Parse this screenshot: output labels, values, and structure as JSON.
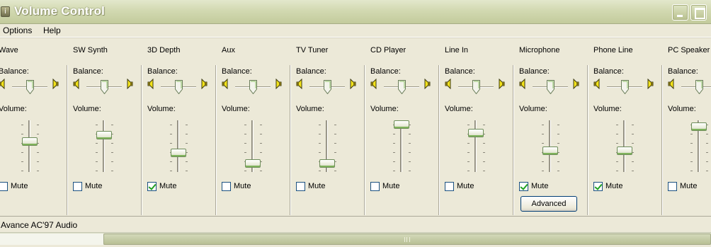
{
  "window": {
    "title": "Volume Control",
    "icon": "volume-app-icon",
    "accent": "#C3CB9C"
  },
  "menu": [
    "Options",
    "Help"
  ],
  "labels": {
    "balance": "Balance:",
    "volume": "Volume:",
    "mute": "Mute",
    "advanced": "Advanced"
  },
  "channels": [
    {
      "name": "Wave",
      "balance": 0.5,
      "volume": 0.6,
      "muted": false
    },
    {
      "name": "SW Synth",
      "balance": 0.5,
      "volume": 0.75,
      "muted": false
    },
    {
      "name": "3D Depth",
      "balance": 0.5,
      "volume": 0.35,
      "muted": true
    },
    {
      "name": "Aux",
      "balance": 0.5,
      "volume": 0.1,
      "muted": false
    },
    {
      "name": "TV Tuner",
      "balance": 0.5,
      "volume": 0.1,
      "muted": false
    },
    {
      "name": "CD Player",
      "balance": 0.5,
      "volume": 1.0,
      "muted": false
    },
    {
      "name": "Line In",
      "balance": 0.5,
      "volume": 0.8,
      "muted": false
    },
    {
      "name": "Microphone",
      "balance": 0.5,
      "volume": 0.4,
      "muted": true,
      "advanced": true
    },
    {
      "name": "Phone Line",
      "balance": 0.5,
      "volume": 0.4,
      "muted": true
    },
    {
      "name": "PC Speaker",
      "balance": 0.5,
      "volume": 0.95,
      "muted": false
    }
  ],
  "status": {
    "device": "Avance AC'97 Audio"
  }
}
